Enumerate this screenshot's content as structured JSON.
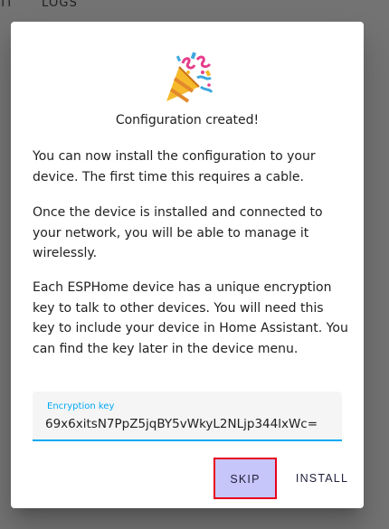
{
  "topbar": {
    "tabs": [
      "DIT",
      "LOGS"
    ]
  },
  "dialog": {
    "icon": "party-popper-icon",
    "title": "Configuration created!",
    "paragraphs": [
      "You can now install the configuration to your device. The first time this requires a cable.",
      "Once the device is installed and connected to your network, you will be able to manage it wirelessly.",
      "Each ESPHome device has a unique encryption key to talk to other devices. You will need this key to include your device in Home Assistant. You can find the key later in the device menu."
    ],
    "encryption_field": {
      "label": "Encryption key",
      "value": "69x6xitsN7PpZ5jqBY5vWkyL2NLjp344lxWc="
    },
    "buttons": {
      "skip": "SKIP",
      "install": "INSTALL"
    }
  },
  "colors": {
    "accent": "#03a9f4",
    "highlight_border": "#e8001c",
    "highlight_fill": "#c6c6fb",
    "scrim": "#737373"
  }
}
